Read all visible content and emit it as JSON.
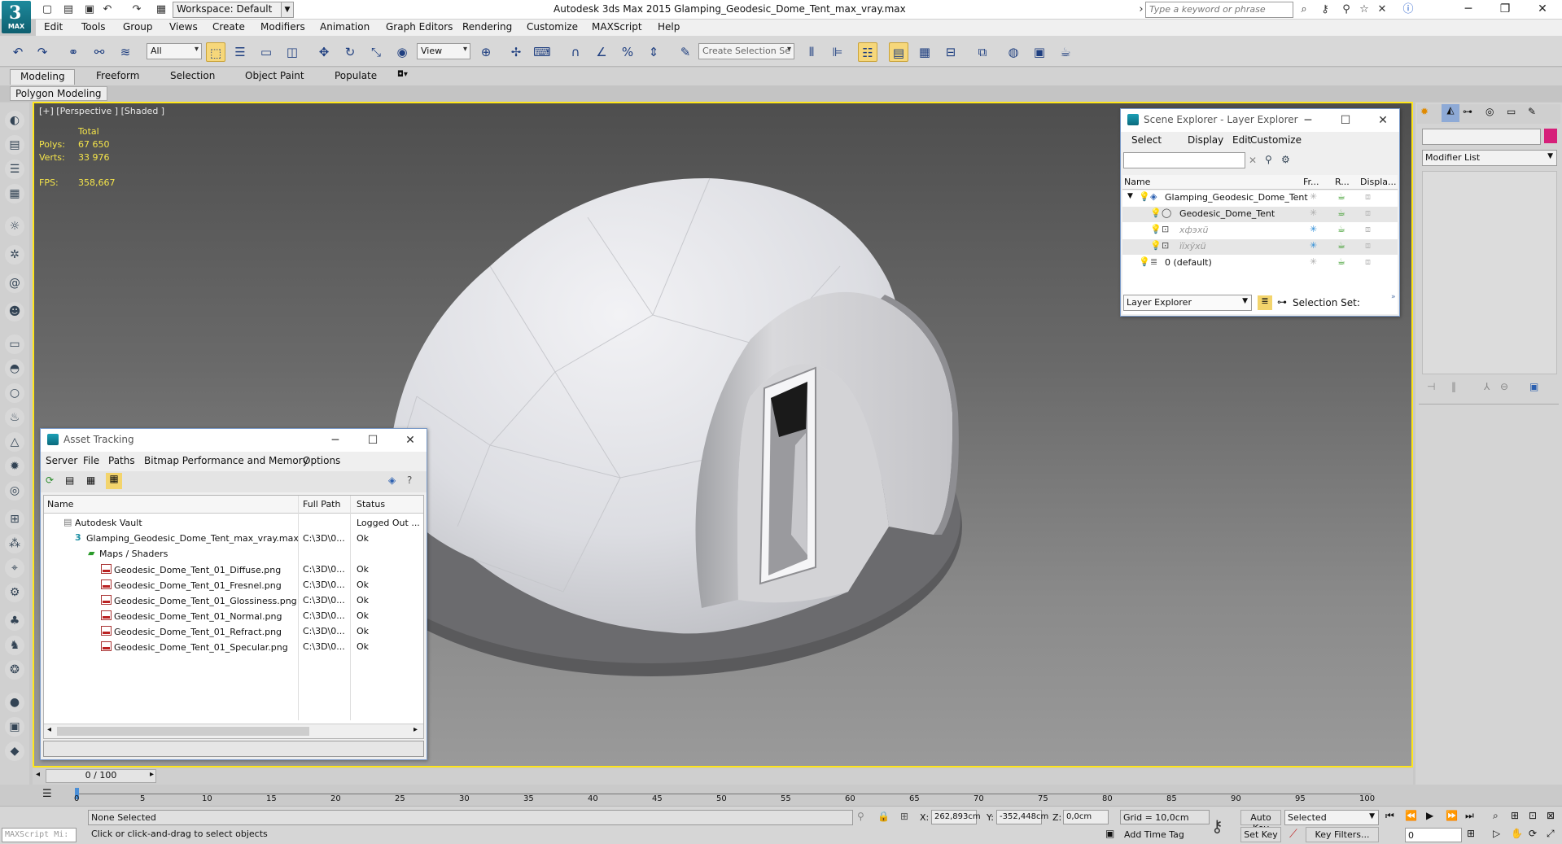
{
  "app": {
    "logo_text": "MAX",
    "title": "Autodesk 3ds Max  2015     Glamping_Geodesic_Dome_Tent_max_vray.max",
    "workspace": "Workspace: Default",
    "search_placeholder": "Type a keyword or phrase"
  },
  "menu": [
    "Edit",
    "Tools",
    "Group",
    "Views",
    "Create",
    "Modifiers",
    "Animation",
    "Graph Editors",
    "Rendering",
    "Customize",
    "MAXScript",
    "Help"
  ],
  "toolbar": {
    "selection_filter": "All",
    "ref_coord": "View",
    "selection_set_placeholder": "Create Selection Se"
  },
  "ribbon": {
    "tabs": [
      "Modeling",
      "Freeform",
      "Selection",
      "Object Paint",
      "Populate"
    ],
    "sub_tab": "Polygon Modeling"
  },
  "viewport": {
    "label": "[+] [Perspective ] [Shaded ]",
    "stats": {
      "header": "Total",
      "polys_label": "Polys:",
      "polys": "67 650",
      "verts_label": "Verts:",
      "verts": "33 976",
      "fps_label": "FPS:",
      "fps": "358,667"
    },
    "colors": {
      "border": "#ffe61a",
      "stats": "#f4e44a"
    }
  },
  "scene_explorer": {
    "title": "Scene Explorer - Layer Explorer",
    "menu": [
      "Select",
      "Display",
      "Edit",
      "Customize"
    ],
    "columns": [
      "Name",
      "Fr...",
      "R...",
      "Displa..."
    ],
    "rows": [
      {
        "name": "Glamping_Geodesic_Dome_Tent"
      },
      {
        "name": "Geodesic_Dome_Tent"
      },
      {
        "name": "хфэхü"
      },
      {
        "name": "їїхўхü"
      },
      {
        "name": "0 (default)"
      }
    ],
    "footer_dropdown": "Layer Explorer",
    "selection_set": "Selection Set:"
  },
  "asset_tracking": {
    "title": "Asset Tracking",
    "menu": [
      "Server",
      "File",
      "Paths",
      "Bitmap Performance and Memory",
      "Options"
    ],
    "columns": [
      "Name",
      "Full Path",
      "Status"
    ],
    "rows": [
      {
        "name": "Autodesk Vault",
        "path": "",
        "status": "Logged Out ..."
      },
      {
        "name": "Glamping_Geodesic_Dome_Tent_max_vray.max",
        "path": "C:\\3D\\0...",
        "status": "Ok"
      },
      {
        "name": "Maps / Shaders",
        "path": "",
        "status": ""
      },
      {
        "name": "Geodesic_Dome_Tent_01_Diffuse.png",
        "path": "C:\\3D\\0...",
        "status": "Ok"
      },
      {
        "name": "Geodesic_Dome_Tent_01_Fresnel.png",
        "path": "C:\\3D\\0...",
        "status": "Ok"
      },
      {
        "name": "Geodesic_Dome_Tent_01_Glossiness.png",
        "path": "C:\\3D\\0...",
        "status": "Ok"
      },
      {
        "name": "Geodesic_Dome_Tent_01_Normal.png",
        "path": "C:\\3D\\0...",
        "status": "Ok"
      },
      {
        "name": "Geodesic_Dome_Tent_01_Refract.png",
        "path": "C:\\3D\\0...",
        "status": "Ok"
      },
      {
        "name": "Geodesic_Dome_Tent_01_Specular.png",
        "path": "C:\\3D\\0...",
        "status": "Ok"
      }
    ]
  },
  "command_panel": {
    "modifier_list": "Modifier List"
  },
  "timeline": {
    "frame": "0 / 100",
    "ticks": [
      "0",
      "5",
      "10",
      "15",
      "20",
      "25",
      "30",
      "35",
      "40",
      "45",
      "50",
      "55",
      "60",
      "65",
      "70",
      "75",
      "80",
      "85",
      "90",
      "95",
      "100"
    ]
  },
  "status": {
    "maxscript": "MAXScript Mi:",
    "selection": "None Selected",
    "prompt": "Click or click-and-drag to select objects",
    "x_label": "X:",
    "x": "262,893cm",
    "y_label": "Y:",
    "y": "-352,448cm",
    "z_label": "Z:",
    "z": "0,0cm",
    "grid": "Grid = 10,0cm",
    "add_time_tag": "Add Time Tag",
    "auto_key": "Auto Key",
    "set_key": "Set Key",
    "key_mode": "Selected",
    "key_filters": "Key Filters...",
    "current_frame": "0"
  }
}
